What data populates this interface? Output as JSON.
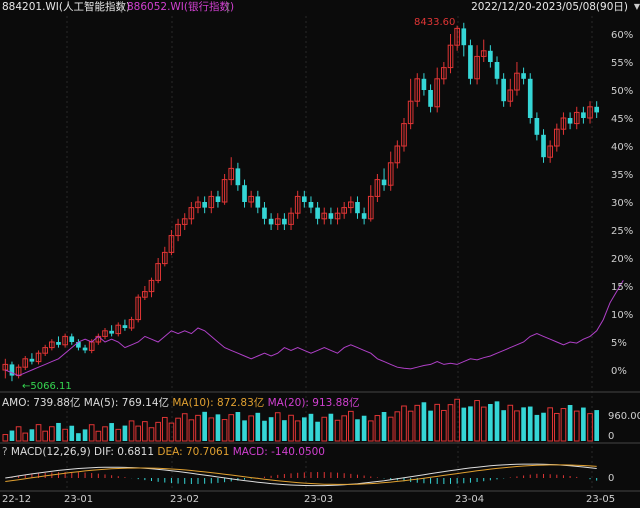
{
  "header": {
    "primary": "884201.WI(人工智能指数)",
    "secondary": "886052.WI(银行指数)",
    "separator": "|",
    "date_range": "2022/12/20-2023/05/08(90日)"
  },
  "colors": {
    "up": "#e03535",
    "down": "#35d6d6",
    "line2": "#b040c8",
    "ma10": "#e0a030",
    "ma20": "#d040d0",
    "ma5": "#dddddd",
    "dif": "#dddddd",
    "dea": "#e0a030"
  },
  "price_panel": {
    "high_label": "8433.60",
    "low_label": "←5066.11",
    "pct_ticks": [
      "60%",
      "55%",
      "50%",
      "45%",
      "40%",
      "35%",
      "30%",
      "25%",
      "20%",
      "15%",
      "10%",
      "5%",
      "0%"
    ]
  },
  "amo_panel": {
    "amo": "AMO: 739.88亿",
    "ma5": "MA(5): 769.14亿",
    "ma10": "MA(10): 872.83亿",
    "ma20": "MA(20): 913.88亿",
    "ticks": [
      "960.00",
      "0"
    ]
  },
  "macd_panel": {
    "q": "?",
    "title": "MACD(12,26,9)",
    "dif": "DIF: 0.6811",
    "dea": "DEA: 70.7061",
    "macd": "MACD: -140.0500",
    "ticks": [
      "0"
    ]
  },
  "x_labels": [
    "22-12",
    "23-01",
    "23-02",
    "23-03",
    "23-04",
    "23-05"
  ],
  "chart_data": {
    "type": "candlestick",
    "candles_pct": [
      [
        0,
        1,
        -1.5,
        2
      ],
      [
        1,
        -1,
        -2,
        1.5
      ],
      [
        -1,
        0.5,
        -1.5,
        1
      ],
      [
        0.5,
        2,
        0,
        2.5
      ],
      [
        2,
        1.5,
        1,
        3
      ],
      [
        1.5,
        3,
        1,
        3.5
      ],
      [
        3,
        4,
        2.5,
        4.5
      ],
      [
        4,
        5,
        3.5,
        5.5
      ],
      [
        5,
        4.5,
        4,
        6
      ],
      [
        4.5,
        6,
        4,
        6.5
      ],
      [
        6,
        5,
        4.5,
        6.5
      ],
      [
        5,
        4,
        3.5,
        5.5
      ],
      [
        4,
        3.5,
        3,
        4.5
      ],
      [
        3.5,
        5,
        3,
        5.5
      ],
      [
        5,
        6,
        4.5,
        6.5
      ],
      [
        6,
        7,
        5.5,
        7.5
      ],
      [
        7,
        6.5,
        6,
        8
      ],
      [
        6.5,
        8,
        6,
        8.5
      ],
      [
        8,
        7.5,
        7,
        9
      ],
      [
        7.5,
        9,
        7,
        9.5
      ],
      [
        9,
        13,
        8.5,
        13.5
      ],
      [
        13,
        14,
        12.5,
        15
      ],
      [
        14,
        16,
        13,
        16.5
      ],
      [
        16,
        19,
        15.5,
        20
      ],
      [
        19,
        21,
        18.5,
        22
      ],
      [
        21,
        24,
        20.5,
        25
      ],
      [
        24,
        26,
        23,
        27
      ],
      [
        26,
        27,
        25,
        28
      ],
      [
        27,
        29,
        26,
        30
      ],
      [
        29,
        30,
        28,
        31
      ],
      [
        30,
        29,
        28,
        31
      ],
      [
        29,
        31,
        28,
        32
      ],
      [
        31,
        30,
        29,
        32
      ],
      [
        30,
        34,
        29.5,
        35
      ],
      [
        34,
        36,
        33,
        38
      ],
      [
        36,
        33,
        32,
        37
      ],
      [
        33,
        30,
        29,
        34
      ],
      [
        30,
        31,
        29,
        32
      ],
      [
        31,
        29,
        28,
        32
      ],
      [
        29,
        27,
        26,
        30
      ],
      [
        27,
        26,
        25,
        28
      ],
      [
        26,
        27,
        25,
        28
      ],
      [
        27,
        26,
        25,
        28
      ],
      [
        26,
        28,
        25,
        29
      ],
      [
        28,
        31,
        27,
        32
      ],
      [
        31,
        30,
        29,
        32
      ],
      [
        30,
        29,
        28,
        31
      ],
      [
        29,
        27,
        26,
        30
      ],
      [
        27,
        28,
        26,
        29
      ],
      [
        28,
        27,
        26,
        29
      ],
      [
        27,
        28,
        26,
        29
      ],
      [
        28,
        29,
        27,
        30
      ],
      [
        29,
        30,
        28,
        31
      ],
      [
        30,
        28,
        27,
        31
      ],
      [
        28,
        27,
        26,
        29
      ],
      [
        27,
        31,
        26.5,
        33
      ],
      [
        31,
        34,
        30,
        35
      ],
      [
        34,
        33,
        32,
        36
      ],
      [
        33,
        37,
        32,
        39
      ],
      [
        37,
        40,
        36,
        41
      ],
      [
        40,
        44,
        39,
        45
      ],
      [
        44,
        48,
        43,
        52
      ],
      [
        48,
        52,
        47,
        53
      ],
      [
        52,
        50,
        49,
        53
      ],
      [
        50,
        47,
        46,
        51
      ],
      [
        47,
        52,
        46,
        54
      ],
      [
        52,
        54,
        51,
        55
      ],
      [
        54,
        58,
        53,
        60
      ],
      [
        58,
        61,
        57,
        61.5
      ],
      [
        61,
        58,
        56,
        62
      ],
      [
        58,
        52,
        51,
        59
      ],
      [
        52,
        56,
        51,
        58
      ],
      [
        56,
        57,
        55,
        59
      ],
      [
        57,
        55,
        54,
        58
      ],
      [
        55,
        52,
        51,
        56
      ],
      [
        52,
        48,
        47,
        53
      ],
      [
        48,
        50,
        47,
        52
      ],
      [
        50,
        53,
        49,
        55
      ],
      [
        53,
        52,
        51,
        54
      ],
      [
        52,
        45,
        44,
        53
      ],
      [
        45,
        42,
        41,
        46
      ],
      [
        42,
        38,
        37,
        43
      ],
      [
        38,
        40,
        37,
        41
      ],
      [
        40,
        43,
        39,
        44
      ],
      [
        43,
        45,
        42,
        46
      ],
      [
        45,
        44,
        43,
        46
      ],
      [
        44,
        46,
        43,
        47
      ],
      [
        46,
        45,
        44,
        47
      ],
      [
        45,
        47,
        44,
        48
      ],
      [
        47,
        46,
        45,
        48
      ]
    ],
    "line2_pct": [
      0,
      -0.5,
      -1,
      -0.5,
      0,
      0.5,
      1,
      1.5,
      2,
      3,
      4,
      5,
      5.5,
      5,
      6,
      5,
      5.5,
      5,
      4,
      4.5,
      5,
      6,
      5.5,
      5,
      6,
      7,
      6.5,
      7,
      6.5,
      7.5,
      7,
      6,
      5,
      4,
      3.5,
      3,
      2.5,
      2,
      2.5,
      3,
      2.5,
      3,
      4,
      3.5,
      4,
      3.5,
      3,
      3.5,
      4,
      3.5,
      3,
      4,
      4.5,
      4,
      3.5,
      3,
      2,
      1.5,
      1,
      0.5,
      0.3,
      0.2,
      0.5,
      0.8,
      1,
      1.5,
      1,
      1.2,
      1,
      1.5,
      2,
      1.8,
      2.2,
      2.5,
      3,
      3.5,
      4,
      4.5,
      5,
      6,
      6.5,
      6,
      5.5,
      5,
      4.5,
      5,
      4.8,
      5.5,
      6,
      7,
      9,
      12,
      14,
      16
    ]
  }
}
